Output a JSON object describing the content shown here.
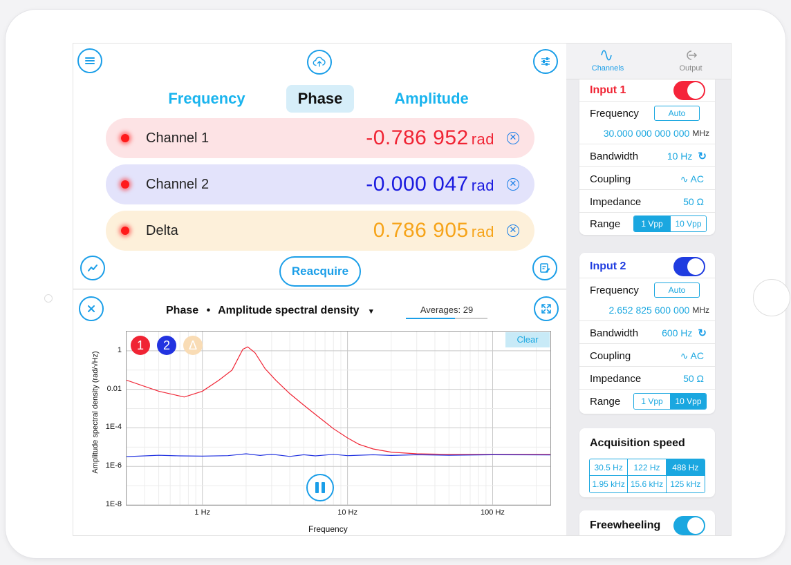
{
  "top": {
    "tabs": [
      {
        "label": "Frequency"
      },
      {
        "label": "Phase"
      },
      {
        "label": "Amplitude"
      }
    ]
  },
  "channels": [
    {
      "name": "Channel 1",
      "value": "-0.786 952",
      "unit": "rad",
      "color": "#f02434",
      "bg": "#fde3e5"
    },
    {
      "name": "Channel 2",
      "value": "-0.000 047",
      "unit": "rad",
      "color": "#1a1adf",
      "bg": "#e3e3fb"
    },
    {
      "name": "Delta",
      "value": "0.786 905",
      "unit": "rad",
      "color": "#f6a41a",
      "bg": "#fdf0da"
    }
  ],
  "reacquire_label": "Reacquire",
  "plot": {
    "header_left": "Phase",
    "header_bullet": "•",
    "header_right": "Amplitude spectral density",
    "header_caret": "▾",
    "averages": "Averages: 29",
    "averages_progress": 0.6,
    "clear_label": "Clear",
    "badges": [
      "1",
      "2",
      "Δ"
    ]
  },
  "chart_data": {
    "type": "line",
    "xlabel": "Frequency",
    "ylabel": "Amplitude spectral density (rad/√Hz)",
    "xscale": "log",
    "yscale": "log",
    "xlim": [
      0.3,
      250
    ],
    "ylim": [
      1e-08,
      10
    ],
    "xticks": [
      {
        "v": 1,
        "label": "1 Hz"
      },
      {
        "v": 10,
        "label": "10 Hz"
      },
      {
        "v": 100,
        "label": "100 Hz"
      }
    ],
    "yticks": [
      {
        "v": 1,
        "label": "1"
      },
      {
        "v": 0.01,
        "label": "0.01"
      },
      {
        "v": 0.0001,
        "label": "1E-4"
      },
      {
        "v": 1e-06,
        "label": "1E-6"
      },
      {
        "v": 1e-08,
        "label": "1E-8"
      }
    ],
    "grid": true,
    "series": [
      {
        "color": "#f02434",
        "x": [
          0.3,
          0.5,
          0.75,
          1.0,
          1.3,
          1.6,
          1.9,
          2.05,
          2.3,
          2.7,
          3.2,
          4,
          5,
          6,
          7,
          8,
          10,
          12,
          15,
          20,
          30,
          50,
          100,
          250
        ],
        "y": [
          0.03,
          0.008,
          0.004,
          0.008,
          0.03,
          0.1,
          1.2,
          1.6,
          0.8,
          0.12,
          0.03,
          0.006,
          0.0015,
          0.0005,
          0.0002,
          9e-05,
          3e-05,
          1.4e-05,
          8e-06,
          5.5e-06,
          4.5e-06,
          4.2e-06,
          4.2e-06,
          4.2e-06
        ]
      },
      {
        "color": "#2233e0",
        "x": [
          0.3,
          0.5,
          0.7,
          1.0,
          1.5,
          2.0,
          2.5,
          3.0,
          4.0,
          5.0,
          6.0,
          8.0,
          10,
          15,
          20,
          30,
          50,
          100,
          250
        ],
        "y": [
          3.2e-06,
          3.8e-06,
          3.5e-06,
          3.4e-06,
          3.6e-06,
          4.5e-06,
          3.7e-06,
          4.3e-06,
          3.3e-06,
          4e-06,
          3.5e-06,
          4.2e-06,
          3.6e-06,
          4e-06,
          3.7e-06,
          4e-06,
          3.8e-06,
          4e-06,
          3.9e-06
        ]
      }
    ]
  },
  "sidebar": {
    "tabs": [
      {
        "label": "Channels",
        "active": true
      },
      {
        "label": "Output",
        "active": false
      }
    ],
    "input1": {
      "title": "Input 1",
      "title_color": "#f02434",
      "toggle_color": "#f5243a",
      "frequency_label": "Frequency",
      "auto_label": "Auto",
      "frequency_value": "30.000 000 000 000",
      "frequency_unit": "MHz",
      "bandwidth_label": "Bandwidth",
      "bandwidth_value": "10 Hz",
      "coupling_label": "Coupling",
      "coupling_value": "AC",
      "impedance_label": "Impedance",
      "impedance_value": "50 Ω",
      "range_label": "Range",
      "range_options": [
        "1 Vpp",
        "10 Vpp"
      ],
      "range_selected": 0
    },
    "input2": {
      "title": "Input 2",
      "title_color": "#1f3ce0",
      "toggle_color": "#1f3ce0",
      "frequency_label": "Frequency",
      "auto_label": "Auto",
      "frequency_value": "2.652 825 600 000",
      "frequency_unit": "MHz",
      "bandwidth_label": "Bandwidth",
      "bandwidth_value": "600 Hz",
      "coupling_label": "Coupling",
      "coupling_value": "AC",
      "impedance_label": "Impedance",
      "impedance_value": "50 Ω",
      "range_label": "Range",
      "range_options": [
        "1 Vpp",
        "10 Vpp"
      ],
      "range_selected": 1
    },
    "acquisition": {
      "title": "Acquisition speed",
      "options": [
        "30.5 Hz",
        "122 Hz",
        "488 Hz",
        "1.95 kHz",
        "15.6 kHz",
        "125 kHz"
      ],
      "selected": 2
    },
    "freewheeling": {
      "label": "Freewheeling",
      "on": true
    }
  },
  "icons": {
    "menu": "menu-icon",
    "upload": "cloud-upload-icon",
    "settings": "sliders-icon",
    "chart": "trend-chart-icon",
    "notes": "edit-notes-icon",
    "close": "close-icon",
    "expand": "expand-icon",
    "pause": "pause-icon"
  }
}
